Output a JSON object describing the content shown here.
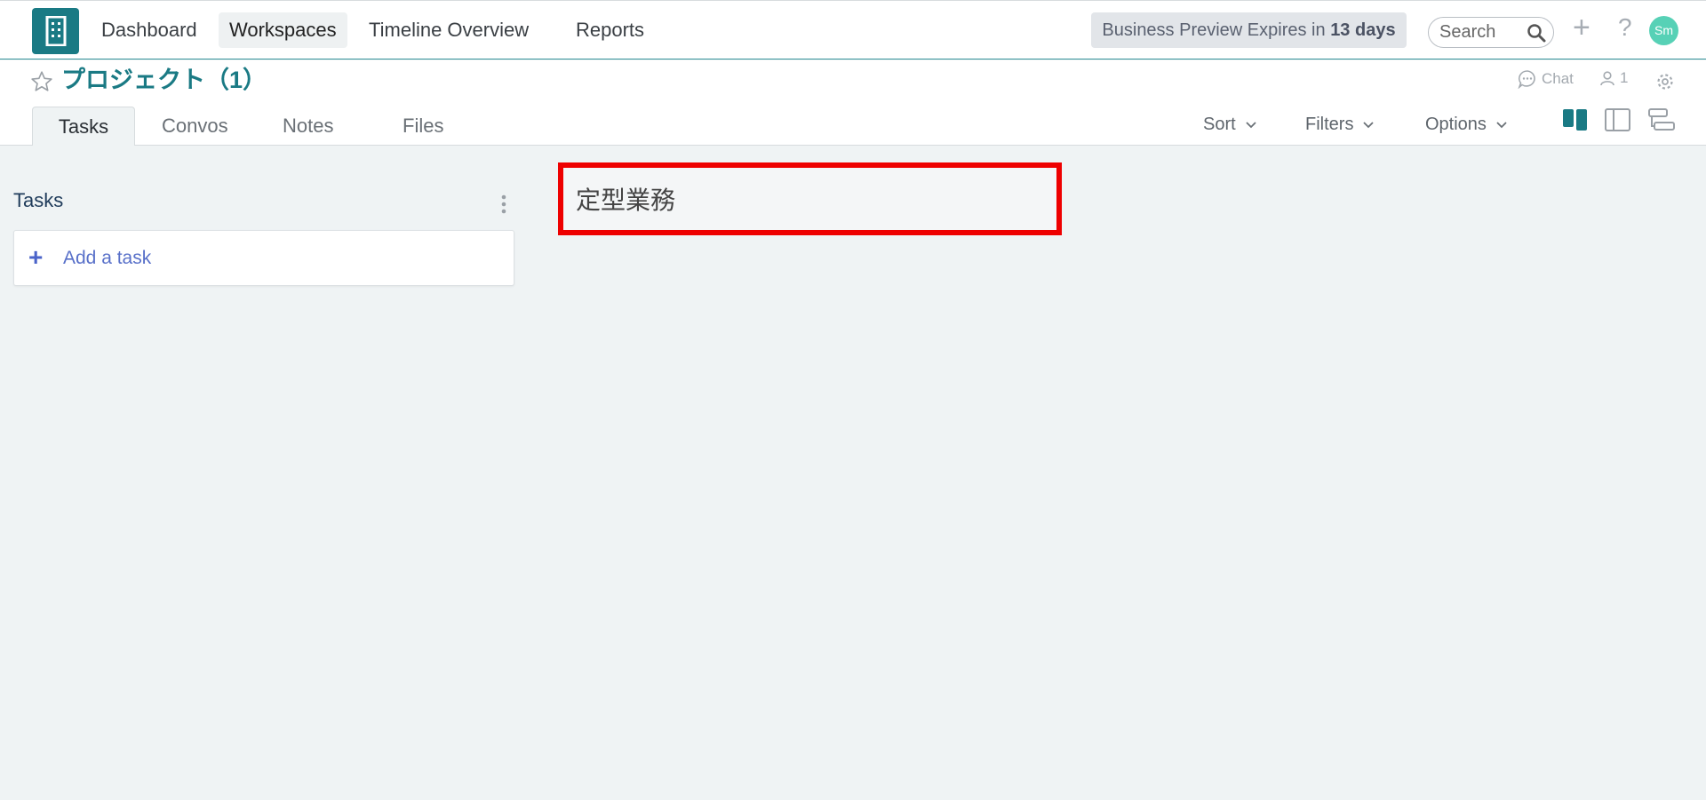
{
  "nav": {
    "links": [
      "Dashboard",
      "Workspaces",
      "Timeline Overview",
      "Reports"
    ],
    "trial_prefix": "Business Preview Expires in",
    "trial_days": "13 days",
    "search_placeholder": "Search",
    "avatar_initials": "Sm"
  },
  "project": {
    "title": "プロジェクト（1）",
    "chat_label": "Chat",
    "member_count": "1"
  },
  "tabs": [
    "Tasks",
    "Convos",
    "Notes",
    "Files"
  ],
  "controls": {
    "sort": "Sort",
    "filters": "Filters",
    "options": "Options"
  },
  "panel": {
    "title": "Tasks",
    "add_task": "Add a task"
  },
  "column_input": {
    "value": "定型業務"
  },
  "colors": {
    "brand": "#1a7a84",
    "highlight": "#ee0000",
    "avatar": "#57d1b6",
    "link_blue": "#5870c9"
  }
}
